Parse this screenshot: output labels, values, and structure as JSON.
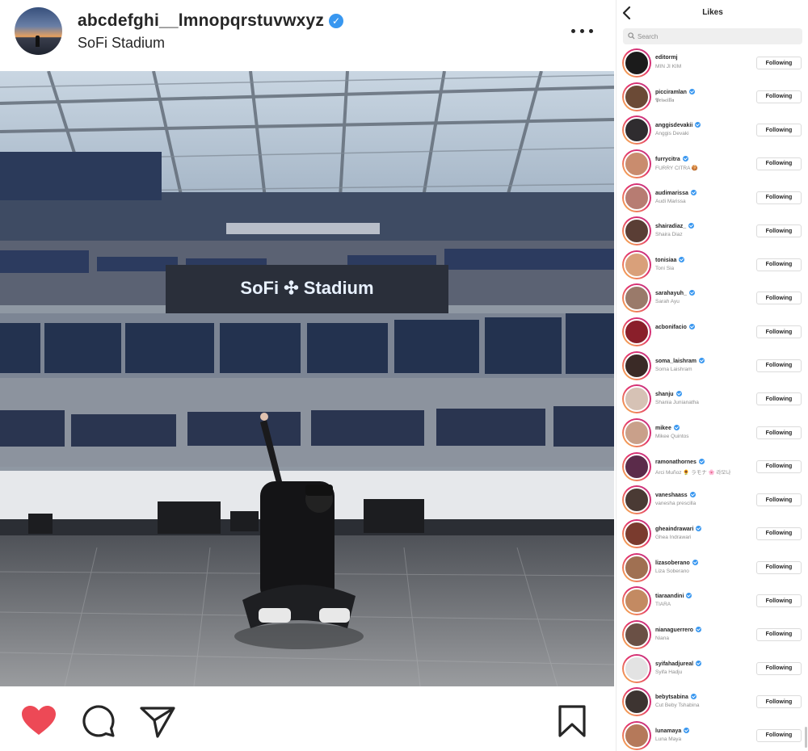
{
  "post": {
    "username": "abcdefghi__lmnopqrstuvwxyz",
    "location": "SoFi Stadium",
    "photo_sign_text": "SoFi",
    "photo_sign_text2": "Stadium"
  },
  "actions": {
    "like": "heart-icon",
    "comment": "comment-icon",
    "share": "send-icon",
    "save": "bookmark-icon",
    "liked_color": "#ed4956"
  },
  "likes_panel": {
    "title": "Likes",
    "search_placeholder": "Search",
    "button_label": "Following",
    "users": [
      {
        "username": "editormj",
        "name": "MIN JI KIM",
        "verified": false,
        "color": "#1b1b1b"
      },
      {
        "username": "picciramlan",
        "name": "𝕻𝖗𝖎𝖘𝖈𝖎𝖑𝖑𝖆",
        "verified": true,
        "color": "#6b4a36"
      },
      {
        "username": "anggisdevakii",
        "name": "Anggis Devaki",
        "verified": true,
        "color": "#2f2c2f"
      },
      {
        "username": "furrycitra",
        "name": "FURRY CITRA 🍪",
        "verified": true,
        "color": "#c98c6e"
      },
      {
        "username": "audimarissa",
        "name": "Audi Marissa",
        "verified": true,
        "color": "#b77c72"
      },
      {
        "username": "shairadiaz_",
        "name": "Shaira Diaz",
        "verified": true,
        "color": "#5a3e35"
      },
      {
        "username": "tonisiaa",
        "name": "Toni Sia",
        "verified": true,
        "color": "#d9a07a"
      },
      {
        "username": "sarahayuh_",
        "name": "Sarah Ayu",
        "verified": true,
        "color": "#9a7a6a"
      },
      {
        "username": "acbonifacio",
        "name": "",
        "verified": true,
        "color": "#8a1f2a"
      },
      {
        "username": "soma_laishram",
        "name": "Soma Laishram",
        "verified": true,
        "color": "#3a2a26"
      },
      {
        "username": "shanju",
        "name": "Shania Junianatha",
        "verified": true,
        "color": "#d6c2b5"
      },
      {
        "username": "mikee",
        "name": "Mikee Quintos",
        "verified": true,
        "color": "#c9a08a"
      },
      {
        "username": "ramonathornes",
        "name": "Arci Muñoz 🌻 ラモナ 🌸 라모나",
        "verified": true,
        "color": "#5b2b4a"
      },
      {
        "username": "vaneshaass",
        "name": "vanesha prescilla",
        "verified": true,
        "color": "#4a3a34"
      },
      {
        "username": "gheaindrawari",
        "name": "Ghea Indrawari",
        "verified": true,
        "color": "#7a3b2e"
      },
      {
        "username": "lizasoberano",
        "name": "Liza Soberano",
        "verified": true,
        "color": "#a07052"
      },
      {
        "username": "tiaraandini",
        "name": "TIARA",
        "verified": true,
        "color": "#c38a62"
      },
      {
        "username": "nianaguerrero",
        "name": "Niana",
        "verified": true,
        "color": "#6a5045"
      },
      {
        "username": "syifahadjureal",
        "name": "Syifa Hadju",
        "verified": true,
        "color": "#e3e3e3"
      },
      {
        "username": "bebytsabina",
        "name": "Cut Beby Tshabina",
        "verified": true,
        "color": "#3d3431"
      },
      {
        "username": "lunamaya",
        "name": "Luna Maya",
        "verified": true,
        "color": "#b5795a"
      }
    ]
  }
}
